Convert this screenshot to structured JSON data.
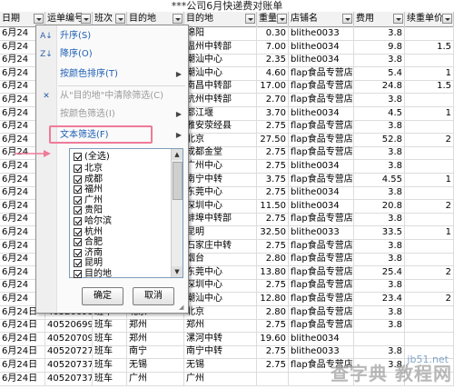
{
  "sheet_title": "***公司6月快递费对账单",
  "headers": [
    "日期",
    "运单编号",
    "班次",
    "目的地",
    "目的地",
    "重量",
    "店铺名",
    "费用",
    "续重单价"
  ],
  "rows": [
    [
      "6月24",
      "",
      "",
      "",
      "绵阳",
      "0.30",
      "blithe0033",
      "3.8",
      ""
    ],
    [
      "6月24",
      "",
      "",
      "",
      "温州中转部",
      "7.00",
      "blithe0034",
      "9.8",
      "1.5"
    ],
    [
      "6月24",
      "",
      "",
      "",
      "潮汕中心",
      "2.35",
      "blithe0034",
      "3.8",
      ""
    ],
    [
      "6月24",
      "",
      "",
      "",
      "潮汕中心",
      "4.60",
      "flap食品专营店",
      "5.4",
      "1"
    ],
    [
      "6月24",
      "",
      "",
      "",
      "南昌中转部",
      "17.00",
      "flap食品专营店",
      "24.8",
      "1.5"
    ],
    [
      "6月24",
      "",
      "",
      "",
      "杭州中转部",
      "2.70",
      "flap食品专营店",
      "3.8",
      ""
    ],
    [
      "6月24",
      "",
      "",
      "",
      "都江堰",
      "3.70",
      "blithe0034",
      "4.5",
      "1"
    ],
    [
      "6月24",
      "",
      "",
      "",
      "雅安荥经县",
      "2.75",
      "flap食品专营店",
      "3.8",
      ""
    ],
    [
      "6月24",
      "",
      "",
      "",
      "北京",
      "27.50",
      "flap食品专营店",
      "52.8",
      "2"
    ],
    [
      "6月24",
      "",
      "",
      "",
      "成都金堂",
      "2.75",
      "flap食品专营店",
      "3.8",
      ""
    ],
    [
      "6月24",
      "",
      "",
      "",
      "广州中心",
      "2.75",
      "blithe0034",
      "3.8",
      ""
    ],
    [
      "6月24",
      "",
      "",
      "",
      "南宁中转",
      "3.75",
      "flap食品专营店",
      "4.55",
      "1"
    ],
    [
      "6月24",
      "",
      "",
      "",
      "东莞中心",
      "2.75",
      "blithe0034",
      "3.8",
      ""
    ],
    [
      "6月24",
      "",
      "",
      "",
      "深圳中心",
      "11.50",
      "blithe0034",
      "20.8",
      "2"
    ],
    [
      "6月24",
      "",
      "",
      "",
      "蚌埠中转部",
      "2.75",
      "flap食品专营店",
      "3.8",
      ""
    ],
    [
      "6月24",
      "",
      "",
      "",
      "昆明",
      "32.50",
      "blithe0033",
      "33.5",
      "1"
    ],
    [
      "6月24",
      "",
      "",
      "",
      "石家庄中转",
      "2.75",
      "flap食品专营店",
      "3.8",
      ""
    ],
    [
      "6月24",
      "",
      "",
      "",
      "烟台",
      "2.80",
      "flap食品专营店",
      "3.8",
      ""
    ],
    [
      "6月24",
      "",
      "",
      "",
      "东莞中心",
      "13.80",
      "flap食品专营店",
      "25.4",
      "2"
    ],
    [
      "6月24",
      "",
      "",
      "",
      "深圳中心",
      "2.75",
      "flap食品专营店",
      "3.8",
      ""
    ],
    [
      "6月24",
      "",
      "",
      "",
      "潮汕中心",
      "12.80",
      "flap食品专营店",
      "23.4",
      "2"
    ],
    [
      "6月24日",
      "4052069919",
      "班车",
      "北京",
      "北京",
      "2.80",
      "flap食品专营店",
      "3.8",
      ""
    ],
    [
      "6月24日",
      "4052069930",
      "班车",
      "郑州",
      "郑州",
      "2.75",
      "flap食品专营店",
      "3.8",
      ""
    ],
    [
      "6月24日",
      "4052070976",
      "班车",
      "郑州",
      "漯河中转",
      "19.60",
      "blithe0034",
      "",
      ""
    ],
    [
      "6月24日",
      "4052072726",
      "班车",
      "南宁",
      "南宁中转",
      "2.75",
      "blithe0033",
      "3.8",
      ""
    ],
    [
      "6月24日",
      "4052073767",
      "班车",
      "无锡",
      "无锡",
      "2.75",
      "flap食品专营店",
      "3.8",
      ""
    ],
    [
      "6月24日",
      "4052073786",
      "班车",
      "广州",
      "广州",
      "",
      "",
      "",
      ""
    ]
  ],
  "menu": {
    "sort_asc": "升序(S)",
    "sort_desc": "降序(O)",
    "sort_color": "按颜色排序(T)",
    "clear_filter": "从\"目的地\"中清除筛选(C)",
    "filter_color": "按颜色筛选(I)",
    "text_filter": "文本筛选(F)",
    "select_all": "(全选)",
    "items": [
      "北京",
      "成都",
      "福州",
      "广州",
      "贵阳",
      "哈尔滨",
      "杭州",
      "合肥",
      "济南",
      "昆明",
      "目的地"
    ],
    "ok": "确定",
    "cancel": "取消"
  },
  "watermark": {
    "site": "jb51.net",
    "text": "查字典 教程网"
  }
}
